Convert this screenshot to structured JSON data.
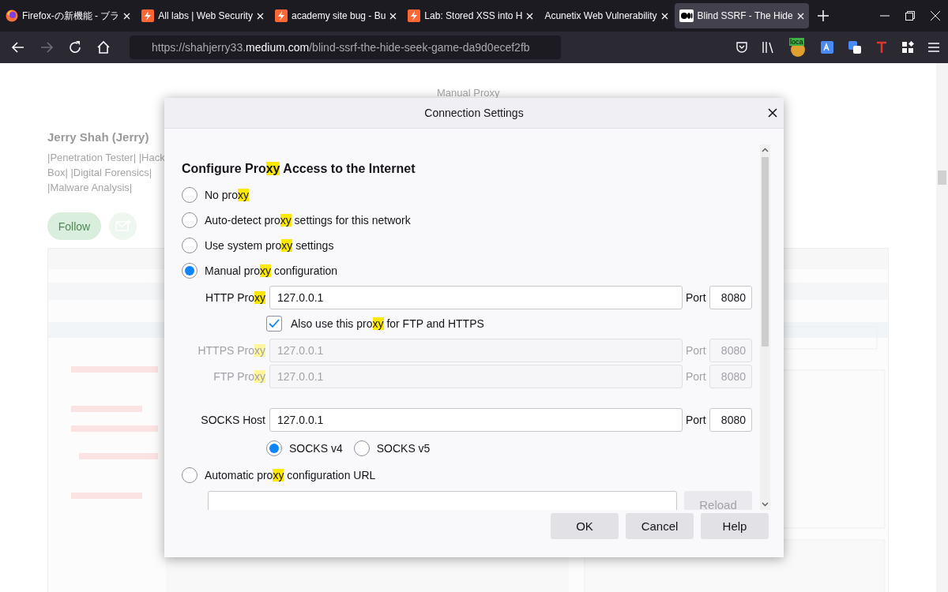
{
  "tabs": [
    {
      "title": "Firefox-の新機能 - ブラ",
      "kind": "browser",
      "selected": false
    },
    {
      "title": "All labs | Web Security",
      "kind": "bolt",
      "selected": false
    },
    {
      "title": "academy site bug - Bu",
      "kind": "bolt",
      "selected": false
    },
    {
      "title": "Lab: Stored XSS into H",
      "kind": "bolt",
      "selected": false
    },
    {
      "title": "Acunetix Web Vulnerability",
      "kind": "none",
      "selected": false
    },
    {
      "title": "Blind SSRF - The Hide",
      "kind": "dots",
      "selected": true
    }
  ],
  "nav": [
    {
      "kind": "back",
      "disabled": false
    },
    {
      "kind": "forward",
      "disabled": true
    },
    {
      "kind": "reload",
      "disabled": false
    },
    {
      "kind": "home",
      "disabled": false
    }
  ],
  "address": "https://shahjerry33.**medium.com**/blind-ssrf-the-hide-seek-game-da9d0ecef2fb",
  "extension_badge": "loca",
  "page": {
    "caption": "Manual Proxy",
    "author": "Jerry Shah (Jerry)",
    "bio": [
      "|Penetration Tester| |Hack",
      "Box| |Digital Forensics|",
      "|Malware Analysis|"
    ],
    "follow": "Follow"
  },
  "dialog": {
    "title": "Connection Settings",
    "heading": [
      {
        "text": "Configure Pro",
        "highlight": false
      },
      {
        "text": "xy",
        "highlight": true
      },
      {
        "text": " Access to the Internet",
        "highlight": false
      }
    ],
    "modes": [
      {
        "parts": [
          {
            "text": "No pro",
            "highlight": false
          },
          {
            "text": "xy",
            "highlight": true
          }
        ],
        "selected": false
      },
      {
        "parts": [
          {
            "text": "Auto-detect pro",
            "highlight": false
          },
          {
            "text": "xy",
            "highlight": true
          },
          {
            "text": " settings for this network",
            "highlight": false
          }
        ],
        "selected": false
      },
      {
        "parts": [
          {
            "text": "Use system pro",
            "highlight": false
          },
          {
            "text": "xy",
            "highlight": true
          },
          {
            "text": " settings",
            "highlight": false
          }
        ],
        "selected": false
      },
      {
        "parts": [
          {
            "text": "Manual pro",
            "highlight": false
          },
          {
            "text": "xy",
            "highlight": true
          },
          {
            "text": " configuration",
            "highlight": false
          }
        ],
        "selected": true,
        "proxies": [
          {
            "parts": [
              {
                "text": "HTTP Pro",
                "highlight": false
              },
              {
                "text": "xy",
                "highlight": true
              }
            ],
            "value": "127.0.0.1",
            "port_label": "Port",
            "port": "8080",
            "disabled": false,
            "share": {
              "parts": [
                {
                  "text": "Also use this pro",
                  "highlight": false
                },
                {
                  "text": "xy",
                  "highlight": true
                },
                {
                  "text": " for FTP and HTTPS",
                  "highlight": false
                }
              ],
              "checked": true
            }
          },
          {
            "parts": [
              {
                "text": "HTTPS Pro",
                "highlight": false
              },
              {
                "text": "xy",
                "highlight": true
              }
            ],
            "value": "127.0.0.1",
            "port_label": "Port",
            "port": "8080",
            "disabled": true
          },
          {
            "parts": [
              {
                "text": "FTP Pro",
                "highlight": false
              },
              {
                "text": "xy",
                "highlight": true
              }
            ],
            "value": "127.0.0.1",
            "port_label": "Port",
            "port": "8080",
            "disabled": true
          }
        ],
        "socks": {
          "label": "SOCKS Host",
          "value": "127.0.0.1",
          "port_label": "Port",
          "port": "8080"
        },
        "socks_versions": [
          {
            "label": "SOCKS v4",
            "selected": true
          },
          {
            "label": "SOCKS v5",
            "selected": false
          }
        ]
      },
      {
        "parts": [
          {
            "text": "Automatic pro",
            "highlight": false
          },
          {
            "text": "xy",
            "highlight": true
          },
          {
            "text": " configuration URL",
            "highlight": false
          }
        ],
        "selected": false,
        "reload": {
          "label": "Reload",
          "disabled": true
        }
      }
    ],
    "buttons": [
      "OK",
      "Cancel",
      "Help"
    ]
  }
}
